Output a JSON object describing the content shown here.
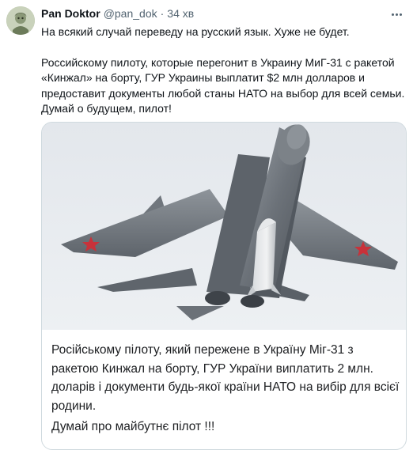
{
  "tweet": {
    "display_name": "Pan Doktor",
    "handle": "@pan_dok",
    "separator": "·",
    "time": "34 хв",
    "text_paragraphs": [
      "На всякий случай переведу на русский язык. Хуже не будет.",
      "Российскому пилоту, которые перегонит в Украину МиГ-31 с ракетой «Кинжал» на борту, ГУР Украины выплатит $2 млн долларов и предоставит документы любой станы НАТО на выбор для всей семьи. Думай о будущем, пилот!"
    ]
  },
  "media": {
    "caption": "Російському пілоту, який пережене в Україну Міг-31 з ракетою Кинжал на борту, ГУР України виплатить 2 млн. доларів і документи будь-якої країни НАТО на вибір для всієї родини.",
    "caption_2": "Думай про майбутнє пілот !!!"
  },
  "colors": {
    "text_primary": "#0f1419",
    "text_secondary": "#536471",
    "border": "#cfd9de",
    "sky": "#e6eaef",
    "aircraft_body": "#6f757c",
    "red_star": "#c8323a"
  },
  "icons": {
    "more": "more-dots-icon"
  }
}
